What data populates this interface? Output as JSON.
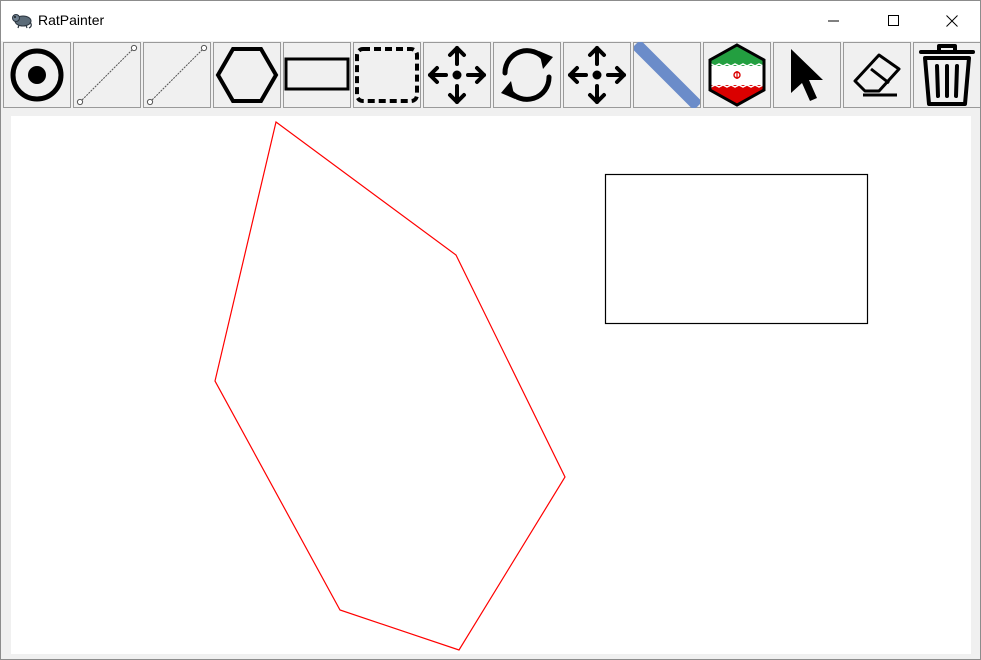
{
  "window": {
    "title": "RatPainter",
    "controls": [
      "minimize",
      "maximize",
      "close"
    ]
  },
  "toolbar": {
    "tools": [
      {
        "name": "point-tool",
        "icon": "circle-dot-icon"
      },
      {
        "name": "line-tool",
        "icon": "line-segment-icon"
      },
      {
        "name": "line-tool-2",
        "icon": "line-segment-icon"
      },
      {
        "name": "polygon-tool",
        "icon": "hexagon-icon"
      },
      {
        "name": "rectangle-tool",
        "icon": "rectangle-icon"
      },
      {
        "name": "selection-tool",
        "icon": "dashed-rounded-rect-icon"
      },
      {
        "name": "move-tool",
        "icon": "move-arrows-icon"
      },
      {
        "name": "rotate-tool",
        "icon": "rotate-arrows-icon"
      },
      {
        "name": "move-tool-2",
        "icon": "move-arrows-icon"
      },
      {
        "name": "thickness-tool",
        "icon": "thick-line-icon"
      },
      {
        "name": "flag-tool",
        "icon": "iran-flag-hexagon-icon"
      },
      {
        "name": "pointer-tool",
        "icon": "cursor-arrow-icon"
      },
      {
        "name": "eraser-tool",
        "icon": "eraser-icon"
      },
      {
        "name": "delete-tool",
        "icon": "trash-can-icon"
      }
    ]
  },
  "colors": {
    "polygon_stroke": "#ff0000",
    "rectangle_stroke": "#000000",
    "thickness_line": "#6b8cc9",
    "flag_green": "#239f40",
    "flag_red": "#da0000"
  }
}
